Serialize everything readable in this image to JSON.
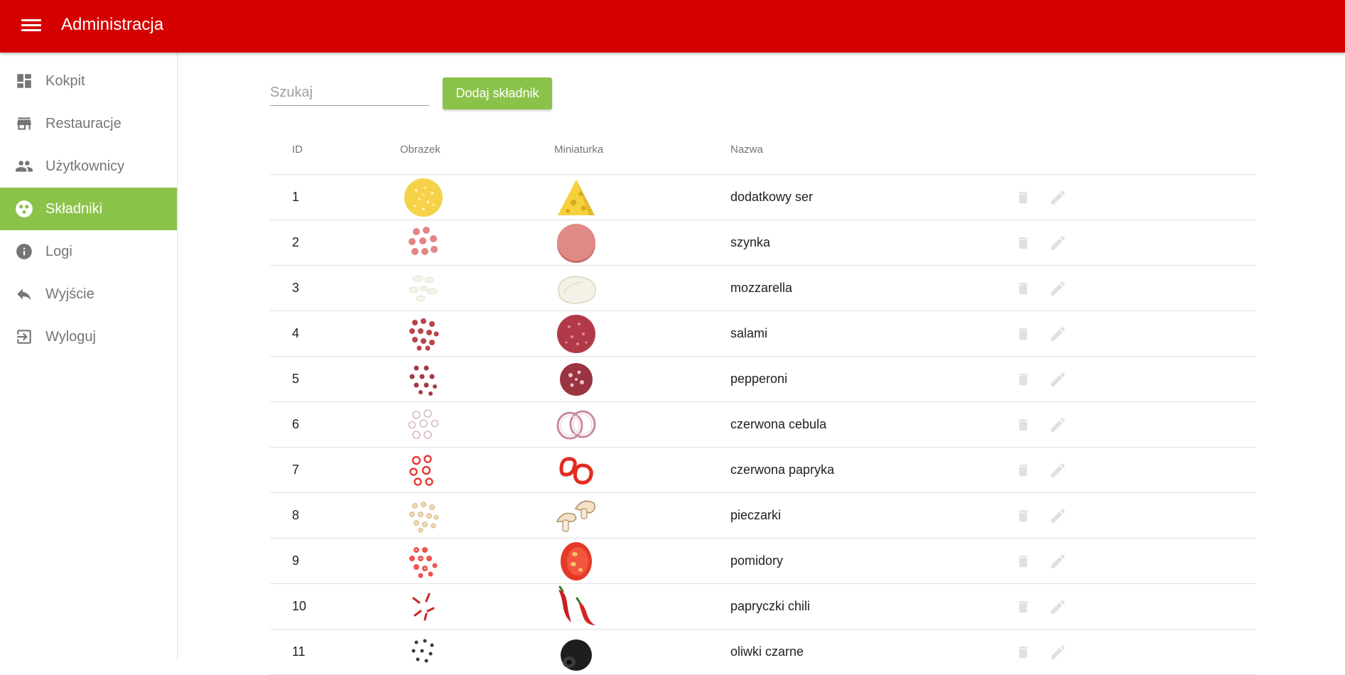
{
  "app": {
    "title": "Administracja"
  },
  "colors": {
    "header": "#d50000",
    "accent": "#8bc34a",
    "icon_muted": "#e0e0e0"
  },
  "sidebar": {
    "items": [
      {
        "label": "Kokpit",
        "icon": "dashboard-icon",
        "active": false
      },
      {
        "label": "Restauracje",
        "icon": "store-icon",
        "active": false
      },
      {
        "label": "Użytkownicy",
        "icon": "people-icon",
        "active": false
      },
      {
        "label": "Składniki",
        "icon": "ingredients-icon",
        "active": true
      },
      {
        "label": "Logi",
        "icon": "info-icon",
        "active": false
      },
      {
        "label": "Wyjście",
        "icon": "reply-icon",
        "active": false
      },
      {
        "label": "Wyloguj",
        "icon": "logout-icon",
        "active": false
      }
    ]
  },
  "toolbar": {
    "search_placeholder": "Szukaj",
    "search_value": "",
    "add_label": "Dodaj składnik"
  },
  "table": {
    "headers": {
      "id": "ID",
      "image": "Obrazek",
      "thumbnail": "Miniaturka",
      "name": "Nazwa"
    },
    "rows": [
      {
        "id": "1",
        "name": "dodatkowy ser",
        "image": "cheese-sprinkle-icon",
        "thumbnail": "cheese-icon"
      },
      {
        "id": "2",
        "name": "szynka",
        "image": "ham-slices-icon",
        "thumbnail": "ham-icon"
      },
      {
        "id": "3",
        "name": "mozzarella",
        "image": "mozzarella-pieces-icon",
        "thumbnail": "mozzarella-icon"
      },
      {
        "id": "4",
        "name": "salami",
        "image": "salami-slices-icon",
        "thumbnail": "salami-icon"
      },
      {
        "id": "5",
        "name": "pepperoni",
        "image": "pepperoni-slices-icon",
        "thumbnail": "pepperoni-icon"
      },
      {
        "id": "6",
        "name": "czerwona cebula",
        "image": "onion-rings-scatter-icon",
        "thumbnail": "onion-rings-icon"
      },
      {
        "id": "7",
        "name": "czerwona papryka",
        "image": "pepper-pieces-icon",
        "thumbnail": "red-pepper-icon"
      },
      {
        "id": "8",
        "name": "pieczarki",
        "image": "mushroom-pieces-icon",
        "thumbnail": "mushrooms-icon"
      },
      {
        "id": "9",
        "name": "pomidory",
        "image": "tomato-slices-icon",
        "thumbnail": "tomato-icon"
      },
      {
        "id": "10",
        "name": "papryczki chili",
        "image": "chili-pieces-icon",
        "thumbnail": "chili-icon"
      },
      {
        "id": "11",
        "name": "oliwki czarne",
        "image": "olive-pieces-icon",
        "thumbnail": "black-olives-icon"
      }
    ]
  }
}
